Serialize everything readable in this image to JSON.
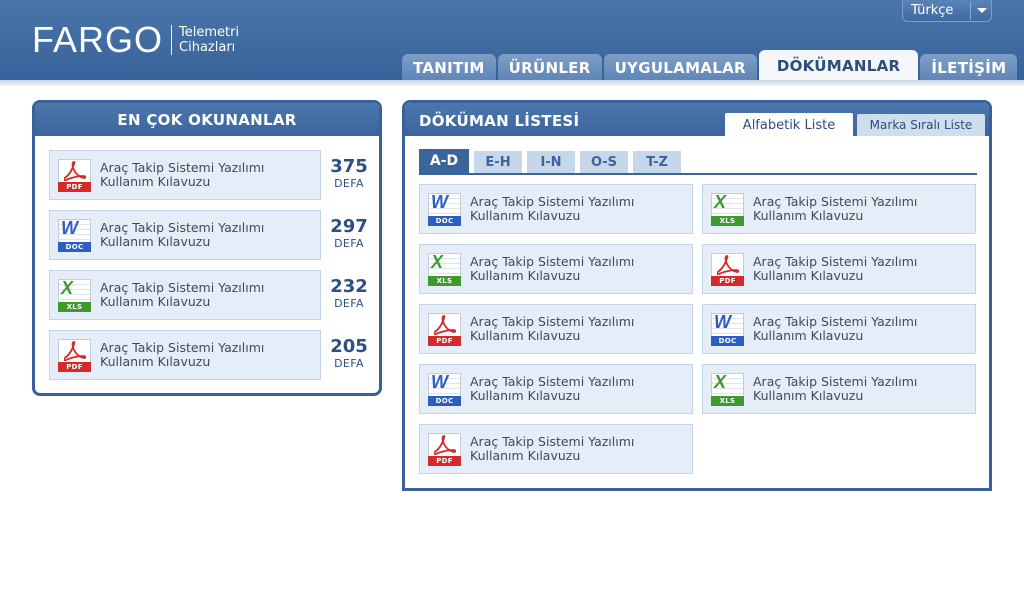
{
  "brand": {
    "name": "FARGO",
    "tagline_line1": "Telemetri",
    "tagline_line2": "Cihazları"
  },
  "language": {
    "selected": "Türkçe"
  },
  "nav": {
    "tabs": [
      {
        "label": "TANITIM"
      },
      {
        "label": "ÜRÜNLER"
      },
      {
        "label": "UYGULAMALAR"
      },
      {
        "label": "DÖKÜMANLAR",
        "active": true
      },
      {
        "label": "İLETİŞİM"
      }
    ]
  },
  "most_read": {
    "title": "EN ÇOK OKUNANLAR",
    "count_unit": "DEFA",
    "items": [
      {
        "type": "PDF",
        "line1": "Araç Takip Sistemi Yazılımı",
        "line2": "Kullanım Kılavuzu",
        "count": "375"
      },
      {
        "type": "DOC",
        "line1": "Araç Takip Sistemi Yazılımı",
        "line2": "Kullanım Kılavuzu",
        "count": "297"
      },
      {
        "type": "XLS",
        "line1": "Araç Takip Sistemi Yazılımı",
        "line2": "Kullanım Kılavuzu",
        "count": "232"
      },
      {
        "type": "PDF",
        "line1": "Araç Takip Sistemi Yazılımı",
        "line2": "Kullanım Kılavuzu",
        "count": "205"
      }
    ]
  },
  "doc_list": {
    "title": "DÖKÜMAN LİSTESİ",
    "sort_tabs": [
      {
        "label": "Alfabetik Liste",
        "active": true
      },
      {
        "label": "Marka Sıralı Liste"
      }
    ],
    "alpha_tabs": [
      {
        "label": "A-D",
        "active": true
      },
      {
        "label": "E-H"
      },
      {
        "label": "I-N"
      },
      {
        "label": "O-S"
      },
      {
        "label": "T-Z"
      }
    ],
    "items": [
      {
        "type": "DOC",
        "line1": "Araç Takip Sistemi Yazılımı",
        "line2": "Kullanım Kılavuzu"
      },
      {
        "type": "XLS",
        "line1": "Araç Takip Sistemi Yazılımı",
        "line2": "Kullanım Kılavuzu"
      },
      {
        "type": "XLS",
        "line1": "Araç Takip Sistemi Yazılımı",
        "line2": "Kullanım Kılavuzu"
      },
      {
        "type": "PDF",
        "line1": "Araç Takip Sistemi Yazılımı",
        "line2": "Kullanım Kılavuzu"
      },
      {
        "type": "PDF",
        "line1": "Araç Takip Sistemi Yazılımı",
        "line2": "Kullanım Kılavuzu"
      },
      {
        "type": "DOC",
        "line1": "Araç Takip Sistemi Yazılımı",
        "line2": "Kullanım Kılavuzu"
      },
      {
        "type": "DOC",
        "line1": "Araç Takip Sistemi Yazılımı",
        "line2": "Kullanım Kılavuzu"
      },
      {
        "type": "XLS",
        "line1": "Araç Takip Sistemi Yazılımı",
        "line2": "Kullanım Kılavuzu"
      },
      {
        "type": "PDF",
        "line1": "Araç Takip Sistemi Yazılımı",
        "line2": "Kullanım Kılavuzu"
      }
    ]
  },
  "icons": {
    "PDF": {
      "name": "pdf-file-icon",
      "color": "#d42a2a"
    },
    "DOC": {
      "name": "word-file-icon",
      "color": "#2c5fc4"
    },
    "XLS": {
      "name": "excel-file-icon",
      "color": "#3e9a2e"
    }
  }
}
